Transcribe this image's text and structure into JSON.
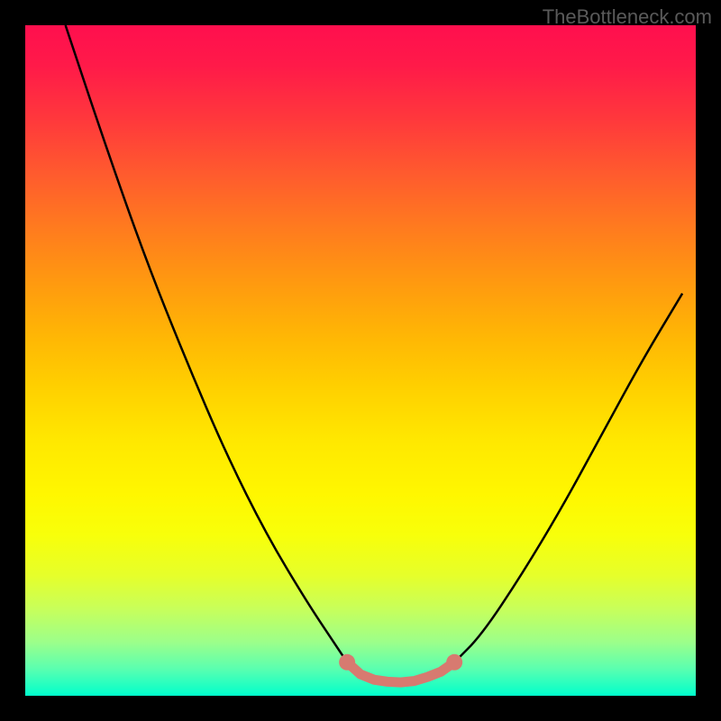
{
  "attribution": "TheBottleneck.com",
  "chart_data": {
    "type": "line",
    "title": "",
    "xlabel": "",
    "ylabel": "",
    "xlim": [
      0,
      100
    ],
    "ylim": [
      0,
      100
    ],
    "gradient_stops": [
      {
        "pct": 0,
        "color": "#ff0f4e"
      },
      {
        "pct": 14,
        "color": "#ff383c"
      },
      {
        "pct": 30,
        "color": "#ff7a1f"
      },
      {
        "pct": 46,
        "color": "#ffb505"
      },
      {
        "pct": 62,
        "color": "#ffe800"
      },
      {
        "pct": 76,
        "color": "#f8ff0a"
      },
      {
        "pct": 87,
        "color": "#c8ff5a"
      },
      {
        "pct": 96,
        "color": "#5affb0"
      },
      {
        "pct": 100,
        "color": "#00ffcc"
      }
    ],
    "series": [
      {
        "name": "left-curve",
        "stroke": "#000000",
        "points": [
          {
            "x": 6,
            "y": 100
          },
          {
            "x": 12,
            "y": 82
          },
          {
            "x": 18,
            "y": 65
          },
          {
            "x": 24,
            "y": 50
          },
          {
            "x": 30,
            "y": 36
          },
          {
            "x": 36,
            "y": 24
          },
          {
            "x": 42,
            "y": 14
          },
          {
            "x": 46,
            "y": 8
          },
          {
            "x": 48,
            "y": 5
          }
        ]
      },
      {
        "name": "right-curve",
        "stroke": "#000000",
        "points": [
          {
            "x": 64,
            "y": 5
          },
          {
            "x": 68,
            "y": 9
          },
          {
            "x": 74,
            "y": 18
          },
          {
            "x": 80,
            "y": 28
          },
          {
            "x": 86,
            "y": 39
          },
          {
            "x": 92,
            "y": 50
          },
          {
            "x": 98,
            "y": 60
          }
        ]
      },
      {
        "name": "valley-markers",
        "stroke": "#d77a70",
        "points": [
          {
            "x": 48,
            "y": 5.0
          },
          {
            "x": 50,
            "y": 3.2
          },
          {
            "x": 52,
            "y": 2.4
          },
          {
            "x": 54,
            "y": 2.1
          },
          {
            "x": 56,
            "y": 2.0
          },
          {
            "x": 58,
            "y": 2.2
          },
          {
            "x": 60,
            "y": 2.8
          },
          {
            "x": 62,
            "y": 3.6
          },
          {
            "x": 64,
            "y": 5.0
          }
        ]
      }
    ]
  }
}
